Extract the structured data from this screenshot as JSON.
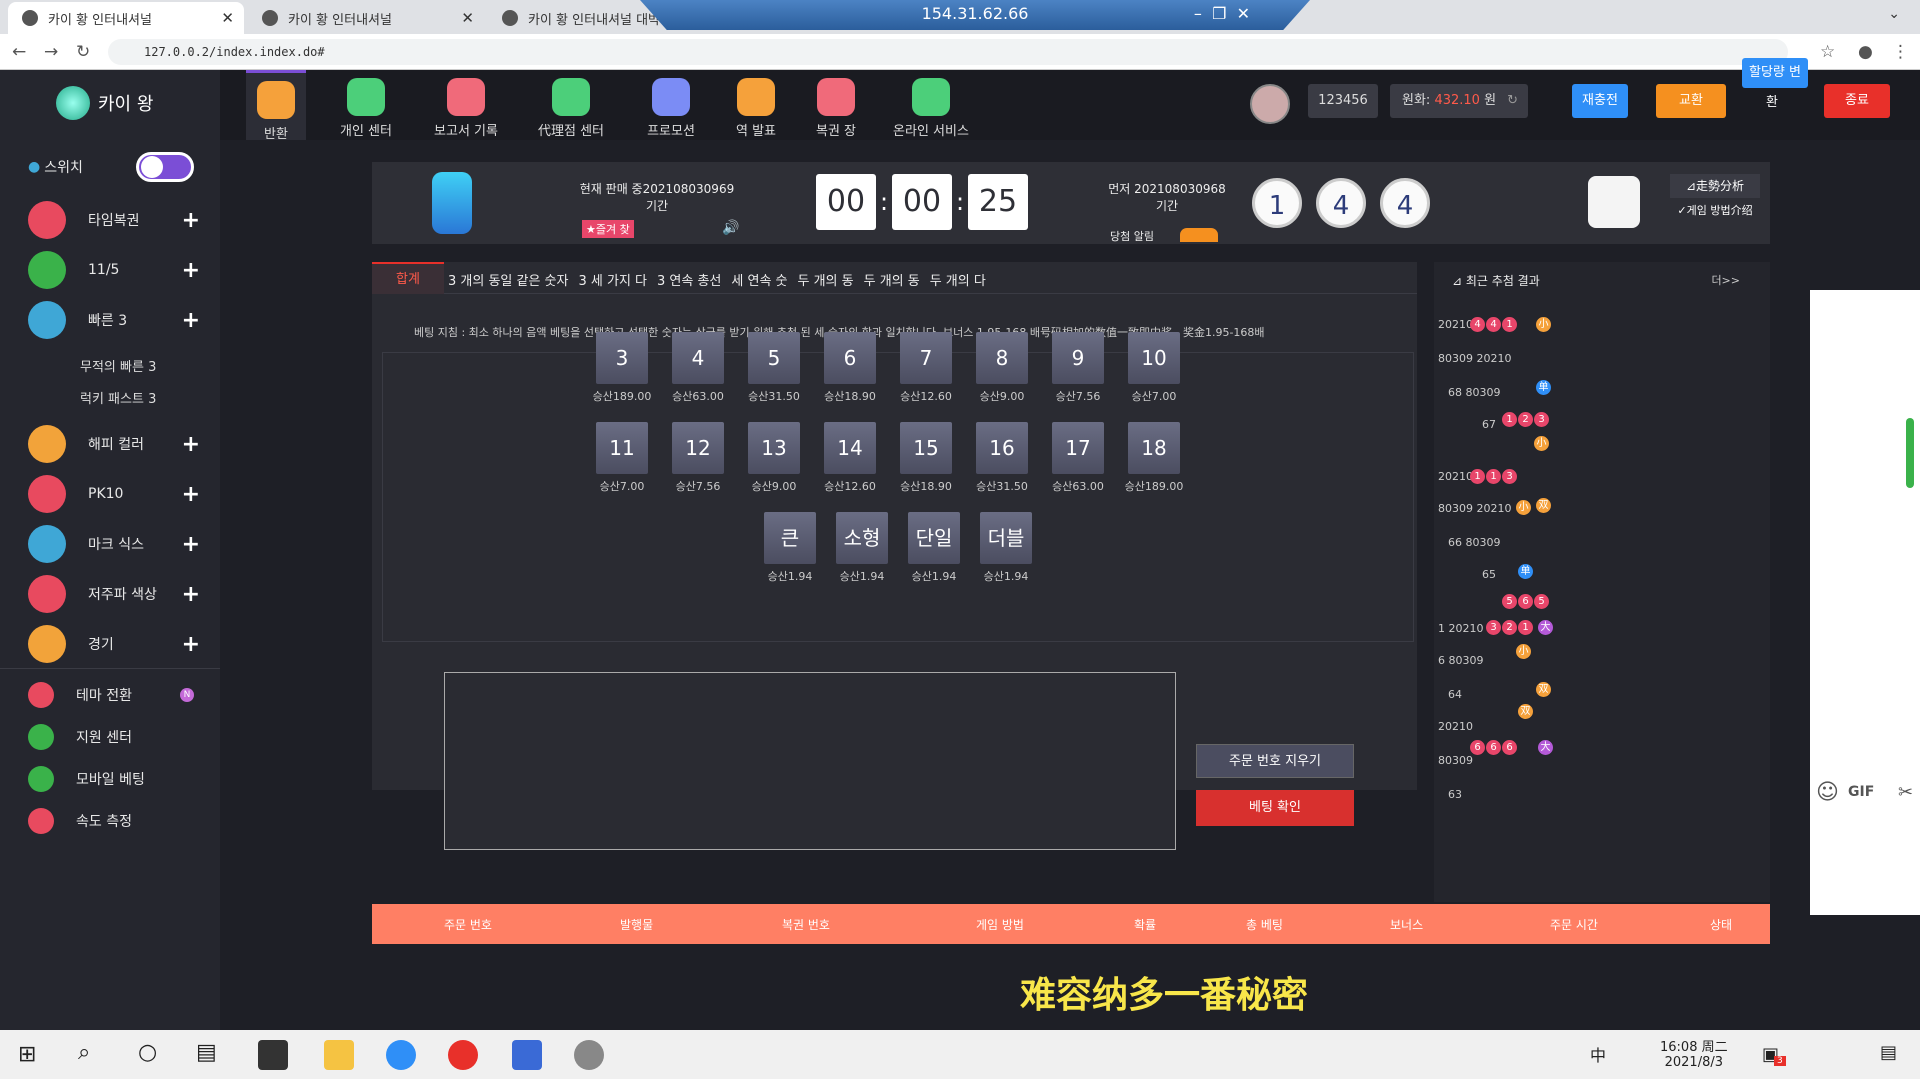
{
  "browser": {
    "tabs": [
      {
        "title": "카이 황 인터내셔널"
      },
      {
        "title": "카이 황 인터내셔널"
      },
      {
        "title": "카이 황 인터내셔널 대박 신속"
      }
    ],
    "remote_title": "154.31.62.66",
    "url": "127.0.0.2/index.index.do#"
  },
  "sidebar": {
    "logo": "카이 왕",
    "switch_label": "스위치",
    "items": [
      {
        "label": "타임복권",
        "color": "#e84a5f"
      },
      {
        "label": "11/5",
        "color": "#3ab24a"
      },
      {
        "label": "빠른 3",
        "color": "#3fa7d6"
      }
    ],
    "sub_items": [
      "무적의 빠른 3",
      "럭키 패스트 3"
    ],
    "items2": [
      {
        "label": "해피 컬러",
        "color": "#f2a33a"
      },
      {
        "label": "PK10",
        "color": "#e84a5f"
      },
      {
        "label": "마크 식스",
        "color": "#3fa7d6"
      },
      {
        "label": "저주파 색상",
        "color": "#e84a5f"
      },
      {
        "label": "경기",
        "color": "#f2a33a"
      }
    ],
    "bottom": [
      {
        "label": "테마 전환",
        "badge": "N"
      },
      {
        "label": "지원 센터"
      },
      {
        "label": "모바일 베팅"
      },
      {
        "label": "속도 측정"
      }
    ]
  },
  "topnav": {
    "items": [
      {
        "label": "반환",
        "color": "#f5a13b"
      },
      {
        "label": "개인 센터",
        "color": "#4ccf7a"
      },
      {
        "label": "보고서 기록",
        "color": "#f06a7a"
      },
      {
        "label": "代理점 센터",
        "color": "#4ccf7a"
      },
      {
        "label": "프로모션",
        "color": "#7b8cf5"
      },
      {
        "label": "역 발표",
        "color": "#f5a13b"
      },
      {
        "label": "복권 장",
        "color": "#f06a7a"
      },
      {
        "label": "온라인 서비스",
        "color": "#4ccf7a"
      }
    ],
    "user_id": "123456",
    "balance_label": "원화:",
    "balance_value": "432.10",
    "balance_unit": "원",
    "recharge": "재충전",
    "exchange": "교환",
    "allocation": "할당량 변",
    "allocation2": "환",
    "logout": "종료"
  },
  "game": {
    "current_label": "현재 판매 중202108030969",
    "current_sub": "기간",
    "fav": "★즐겨 찾",
    "timer": [
      "00",
      "00",
      "25"
    ],
    "prev_label": "먼저 202108030968",
    "prev_sub": "기간",
    "alert_label": "당첨 알림",
    "balls": [
      "1",
      "4",
      "4"
    ],
    "trend": "走勢分析",
    "rules": "게임 방법介绍"
  },
  "bet_tabs": [
    "합계",
    "3 개의 동일 같은 숫자",
    "3 세 가지 다",
    "3 연속 총선",
    "세 연속 숫",
    "두 개의 동",
    "두 개의 동",
    "두 개의 다"
  ],
  "bet_hint": "베팅 지침 : 최소 하나의 음액 베팅을 선택하고 선택한 숫자는 상금를 받기 위해 추첨 된 세 숫자의 합과 일치합니다. 보너스 1.95-168 배号码相加的数值一致即中奖。奖金1.95-168배",
  "numbers_row1": [
    {
      "n": "3",
      "odds": "승산189.00"
    },
    {
      "n": "4",
      "odds": "승산63.00"
    },
    {
      "n": "5",
      "odds": "승산31.50"
    },
    {
      "n": "6",
      "odds": "승산18.90"
    },
    {
      "n": "7",
      "odds": "승산12.60"
    },
    {
      "n": "8",
      "odds": "승산9.00"
    },
    {
      "n": "9",
      "odds": "승산7.56"
    },
    {
      "n": "10",
      "odds": "승산7.00"
    }
  ],
  "numbers_row2": [
    {
      "n": "11",
      "odds": "승산7.00"
    },
    {
      "n": "12",
      "odds": "승산7.56"
    },
    {
      "n": "13",
      "odds": "승산9.00"
    },
    {
      "n": "14",
      "odds": "승산12.60"
    },
    {
      "n": "15",
      "odds": "승산18.90"
    },
    {
      "n": "16",
      "odds": "승산31.50"
    },
    {
      "n": "17",
      "odds": "승산63.00"
    },
    {
      "n": "18",
      "odds": "승산189.00"
    }
  ],
  "numbers_row3": [
    {
      "n": "큰",
      "odds": "승산1.94"
    },
    {
      "n": "소형",
      "odds": "승산1.94"
    },
    {
      "n": "단일",
      "odds": "승산1.94"
    },
    {
      "n": "더블",
      "odds": "승산1.94"
    }
  ],
  "clear_btn": "주문 번호 지우기",
  "confirm_btn": "베팅 확인",
  "results": {
    "title": "최근 추첨 결과",
    "more": "더>>"
  },
  "table_headers": [
    "주문 번호",
    "발행물",
    "복권 번호",
    "게임 방법",
    "확률",
    "총 베팅",
    "보너스",
    "주문 시간",
    "상태"
  ],
  "subtitle": "难容纳多一番秘密",
  "taskbar": {
    "time": "16:08 周二",
    "date": "2021/8/3",
    "ime": "中",
    "notif": "3"
  }
}
